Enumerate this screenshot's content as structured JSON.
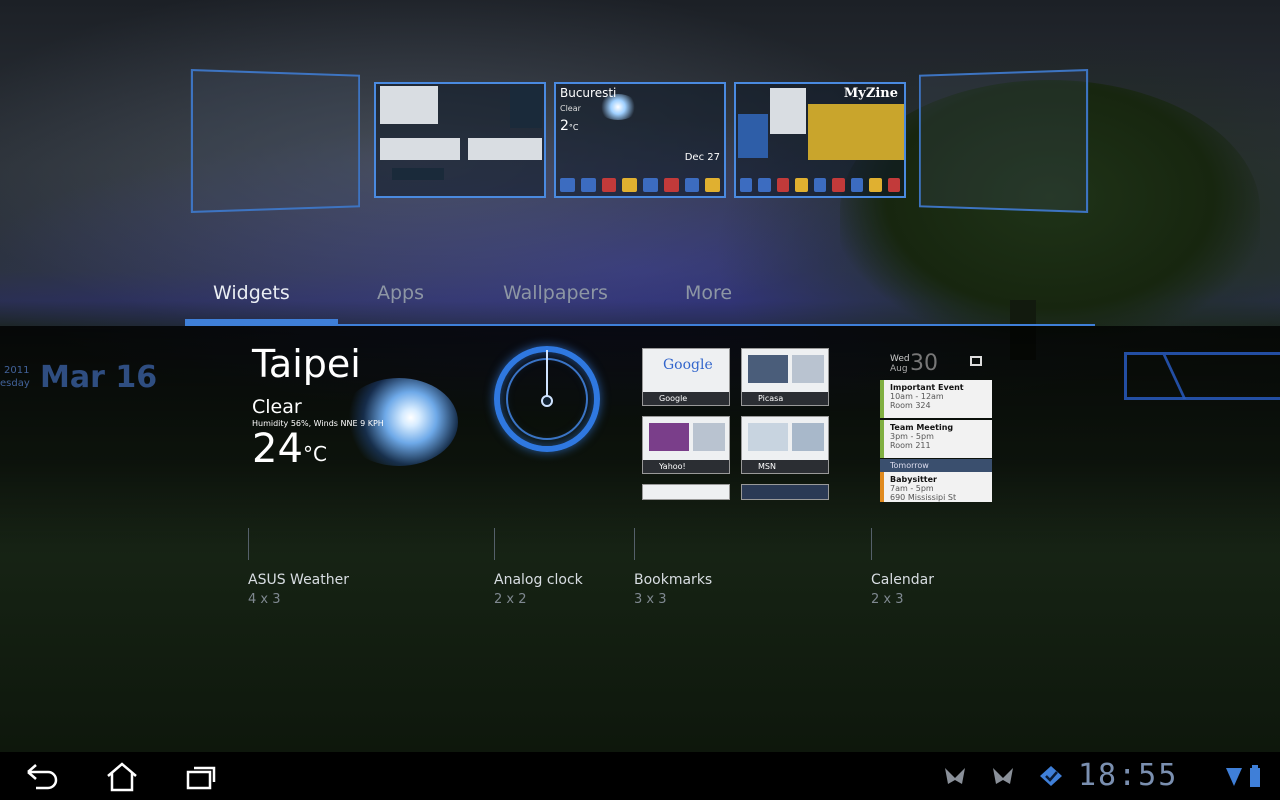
{
  "home_screens": {
    "weather_preview": {
      "city": "Bucuresti",
      "condition": "Clear",
      "temp": "2",
      "unit": "°C",
      "date": "Dec 27"
    },
    "news_preview": {
      "logo": "MyZine"
    }
  },
  "tabs": [
    {
      "label": "Widgets",
      "active": true
    },
    {
      "label": "Apps",
      "active": false
    },
    {
      "label": "Wallpapers",
      "active": false
    },
    {
      "label": "More",
      "active": false
    }
  ],
  "background_clock": {
    "year": "2011",
    "weekday": "esday",
    "date": "Mar 16"
  },
  "weather_widget": {
    "city": "Taipei",
    "condition": "Clear",
    "details": "Humidity 56%, Winds NNE 9 KPH",
    "temp": "24",
    "unit": "°C"
  },
  "bookmarks_widget": {
    "items": [
      "Google",
      "Picasa",
      "Yahoo!",
      "MSN"
    ],
    "google_logo": "Google"
  },
  "calendar_widget": {
    "weekday": "Wed",
    "month": "Aug",
    "day": "30",
    "events": [
      {
        "title": "Important Event",
        "time": "10am - 12am",
        "place": "Room 324"
      },
      {
        "title": "Team Meeting",
        "time": "3pm - 5pm",
        "place": "Room 211"
      },
      {
        "title": "Babysitter",
        "time": "7am - 5pm",
        "place": "690 Mississipi St"
      }
    ],
    "tomorrow_label": "Tomorrow"
  },
  "widget_labels": [
    {
      "name": "ASUS Weather",
      "size": "4 x 3"
    },
    {
      "name": "Analog clock",
      "size": "2 x 2"
    },
    {
      "name": "Bookmarks",
      "size": "3 x 3"
    },
    {
      "name": "Calendar",
      "size": "2 x 3"
    }
  ],
  "system_bar": {
    "time": "18:55",
    "icons": [
      "back-icon",
      "home-icon",
      "recent-apps-icon",
      "notification-icon",
      "notification-icon",
      "sync-icon",
      "signal-icon",
      "battery-icon"
    ]
  },
  "colors": {
    "accent": "#3f7fd8",
    "tab_inactive": "#8d96a4",
    "clock_text": "#7a8fb0"
  }
}
